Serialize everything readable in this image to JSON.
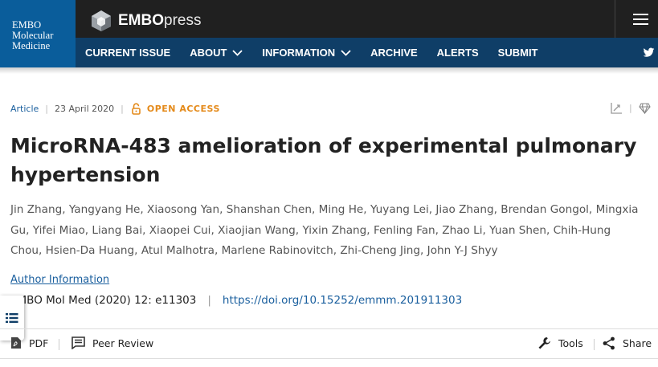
{
  "journal": {
    "line1": "EMBO",
    "line2": "Molecular",
    "line3": "Medicine"
  },
  "publisher": {
    "bold": "EMBO",
    "rest": "press"
  },
  "nav": {
    "items": [
      {
        "label": "CURRENT ISSUE",
        "dropdown": false
      },
      {
        "label": "ABOUT",
        "dropdown": true
      },
      {
        "label": "INFORMATION",
        "dropdown": true
      },
      {
        "label": "ARCHIVE",
        "dropdown": false
      },
      {
        "label": "ALERTS",
        "dropdown": false
      },
      {
        "label": "SUBMIT",
        "dropdown": false
      }
    ]
  },
  "article": {
    "type": "Article",
    "date": "23 April 2020",
    "access": "OPEN ACCESS",
    "title": "MicroRNA-483 amelioration of experimental pulmonary hypertension",
    "authors": "Jin Zhang, Yangyang He, Xiaosong Yan, Shanshan Chen, Ming He, Yuyang Lei, Jiao Zhang, Brendan Gongol, Mingxia Gu, Yifei Miao, Liang Bai, Xiaopei Cui, Xiaojian Wang, Yixin Zhang, Fenling Fan, Zhao Li, Yuan Shen, Chih-Hung Chou, Hsien-Da Huang, Atul Malhotra, Marlene Rabinovitch, Zhi-Cheng Jing, John Y-J Shyy",
    "author_info": "Author Information",
    "citation": "EMBO Mol Med (2020) 12: e11303",
    "doi": "https://doi.org/10.15252/emmm.201911303"
  },
  "toolbar": {
    "pdf": "PDF",
    "peer_review": "Peer Review",
    "tools": "Tools",
    "share": "Share"
  },
  "colors": {
    "brand_dark": "#0f3e67",
    "brand_light": "#0a5d9b",
    "link": "#1a5f9e",
    "open_access": "#e48a1a"
  }
}
